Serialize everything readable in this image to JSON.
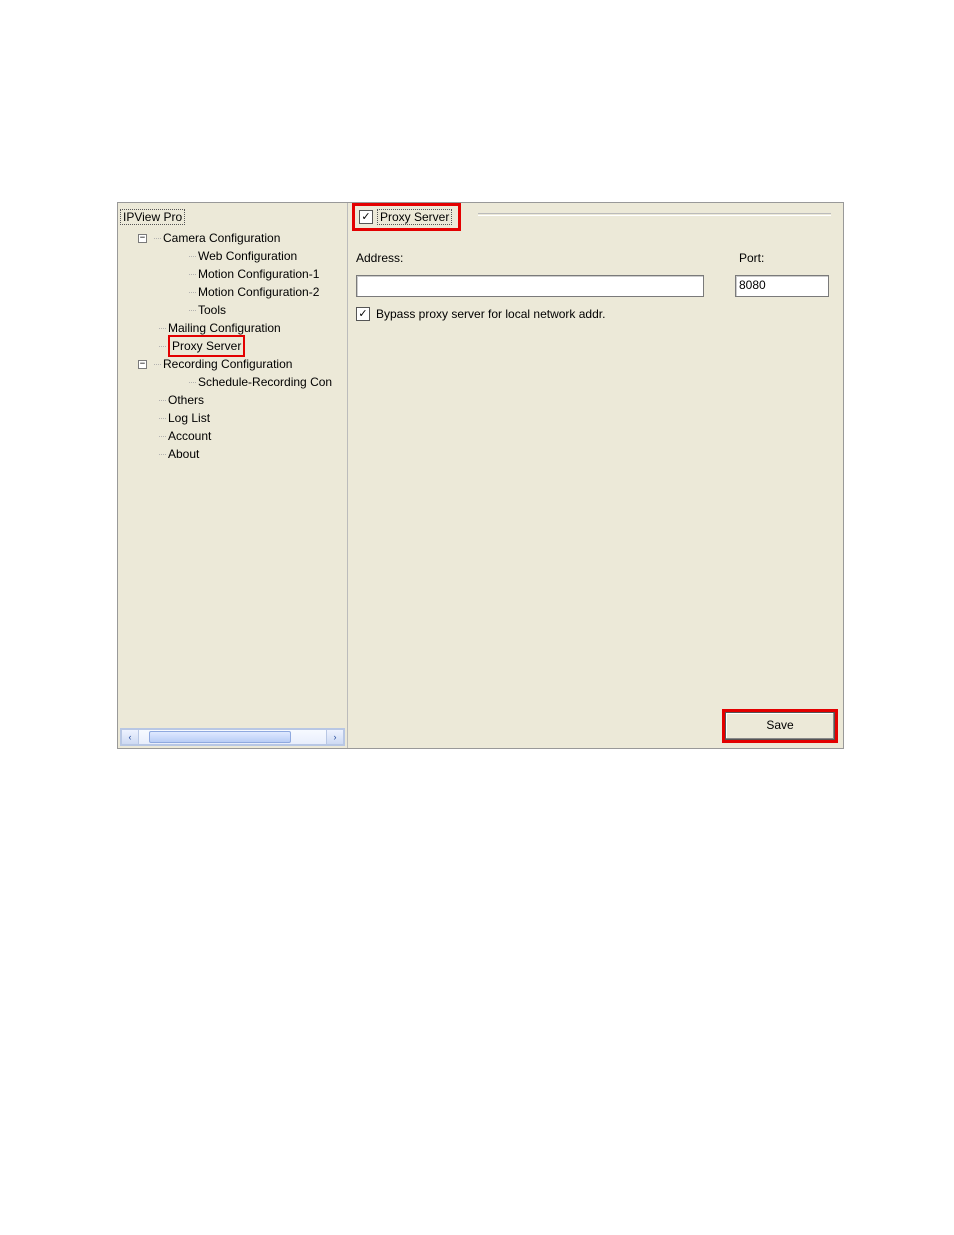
{
  "tree": {
    "root": "IPView Pro",
    "camera_cfg": "Camera Configuration",
    "web_cfg": "Web Configuration",
    "motion1": "Motion Configuration-1",
    "motion2": "Motion Configuration-2",
    "tools": "Tools",
    "mailing": "Mailing Configuration",
    "proxy": "Proxy Server",
    "recording": "Recording Configuration",
    "sched_rec": "Schedule-Recording Con",
    "others": "Others",
    "loglist": "Log List",
    "account": "Account",
    "about": "About",
    "toggle_minus": "−"
  },
  "panel": {
    "groupbox_label": "Proxy Server",
    "proxy_enabled_check": "✓",
    "address_label": "Address:",
    "address_value": "",
    "port_label": "Port:",
    "port_value": "8080",
    "bypass_check": "✓",
    "bypass_label": "Bypass proxy server for local network addr.",
    "save_label": "Save"
  },
  "scrollbar": {
    "left": "‹",
    "right": "›"
  }
}
